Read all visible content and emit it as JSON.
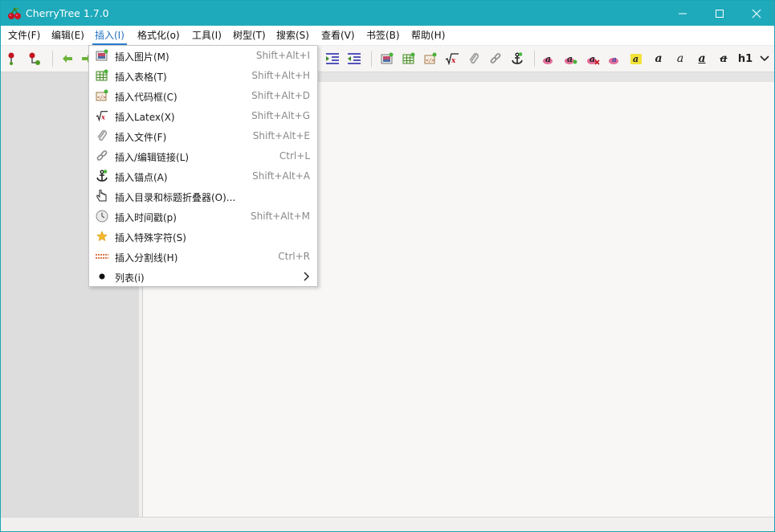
{
  "window": {
    "title": "CherryTree 1.7.0",
    "accent_color": "#1eaabb"
  },
  "menubar": {
    "items": [
      {
        "label": "文件(F)"
      },
      {
        "label": "编辑(E)"
      },
      {
        "label": "插入(I)",
        "active": true
      },
      {
        "label": "格式化(o)"
      },
      {
        "label": "工具(I)"
      },
      {
        "label": "树型(T)"
      },
      {
        "label": "搜索(S)"
      },
      {
        "label": "查看(V)"
      },
      {
        "label": "书签(B)"
      },
      {
        "label": "帮助(H)"
      }
    ]
  },
  "toolbar": {
    "h1_label": "h1",
    "icons": [
      "add-node-icon",
      "add-subnode-icon",
      "back-arrow-icon",
      "forward-arrow-icon",
      "indent-icon",
      "unindent-icon",
      "insert-image-icon",
      "insert-table-icon",
      "insert-codebox-icon",
      "insert-latex-icon",
      "insert-file-icon",
      "insert-link-icon",
      "insert-anchor-icon",
      "text-color-icon",
      "highlight-color-icon",
      "remove-format-icon",
      "small-format-icon",
      "mark-format-icon",
      "bold-icon",
      "italic-icon",
      "underline-icon",
      "strikethrough-icon",
      "h1-icon",
      "more-chevron-icon"
    ]
  },
  "insert_menu": {
    "items": [
      {
        "icon": "image-icon",
        "label": "插入图片(M)",
        "shortcut": "Shift+Alt+I"
      },
      {
        "icon": "table-icon",
        "label": "插入表格(T)",
        "shortcut": "Shift+Alt+H"
      },
      {
        "icon": "codebox-icon",
        "label": "插入代码框(C)",
        "shortcut": "Shift+Alt+D"
      },
      {
        "icon": "latex-icon",
        "label": "插入Latex(X)",
        "shortcut": "Shift+Alt+G"
      },
      {
        "icon": "paperclip-icon",
        "label": "插入文件(F)",
        "shortcut": "Shift+Alt+E"
      },
      {
        "icon": "chain-link-icon",
        "label": "插入/编辑链接(L)",
        "shortcut": "Ctrl+L"
      },
      {
        "icon": "anchor-icon",
        "label": "插入锚点(A)",
        "shortcut": "Shift+Alt+A"
      },
      {
        "icon": "pointing-hand-icon",
        "label": "插入目录和标题折叠器(O)...",
        "shortcut": ""
      },
      {
        "icon": "clock-icon",
        "label": "插入时间戳(p)",
        "shortcut": "Shift+Alt+M"
      },
      {
        "icon": "star-icon",
        "label": "插入特殊字符(S)",
        "shortcut": ""
      },
      {
        "icon": "separator-line-icon",
        "label": "插入分割线(H)",
        "shortcut": "Ctrl+R"
      },
      {
        "icon": "bullet-icon",
        "label": "列表(i)",
        "shortcut": "",
        "submenu": true
      }
    ]
  }
}
